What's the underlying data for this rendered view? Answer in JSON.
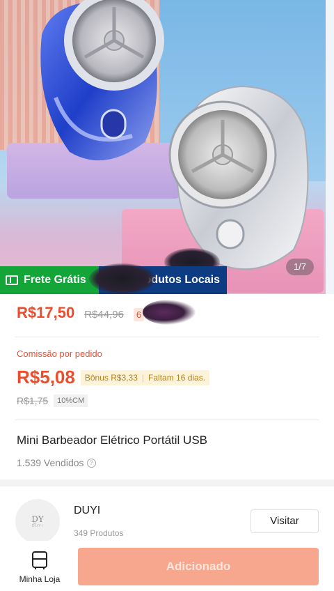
{
  "image": {
    "pager": "1/7",
    "badges": {
      "free_shipping": "Frete Grátis",
      "local_products": "odutos Locais"
    }
  },
  "price": {
    "current": "R$17,50",
    "original": "R$44,96",
    "discount": "6"
  },
  "commission": {
    "title": "Comissão por pedido",
    "value": "R$5,08",
    "bonus": "Bônus R$3,33",
    "remaining": "Faltam 16 dias.",
    "old_value": "R$1,75",
    "rate": "10%CM"
  },
  "product": {
    "name": "Mini Barbeador Elétrico Portátil USB",
    "sold": "1.539 Vendidos",
    "help_glyph": "?"
  },
  "shop": {
    "logo_mark": "ḎY",
    "logo_caption": "DUYI",
    "name": "DUYI",
    "products": "349 Produtos",
    "visit_label": "Visitar"
  },
  "bottom_bar": {
    "my_store_label": "Minha Loja",
    "add_label": "Adicionado"
  },
  "colors": {
    "accent": "#ee4d2d",
    "free_shipping_green": "#13a538",
    "local_blue": "#0e3c82",
    "add_button": "#f7a78d"
  },
  "icons": [
    "ticket-icon",
    "help-icon",
    "store-icon"
  ]
}
